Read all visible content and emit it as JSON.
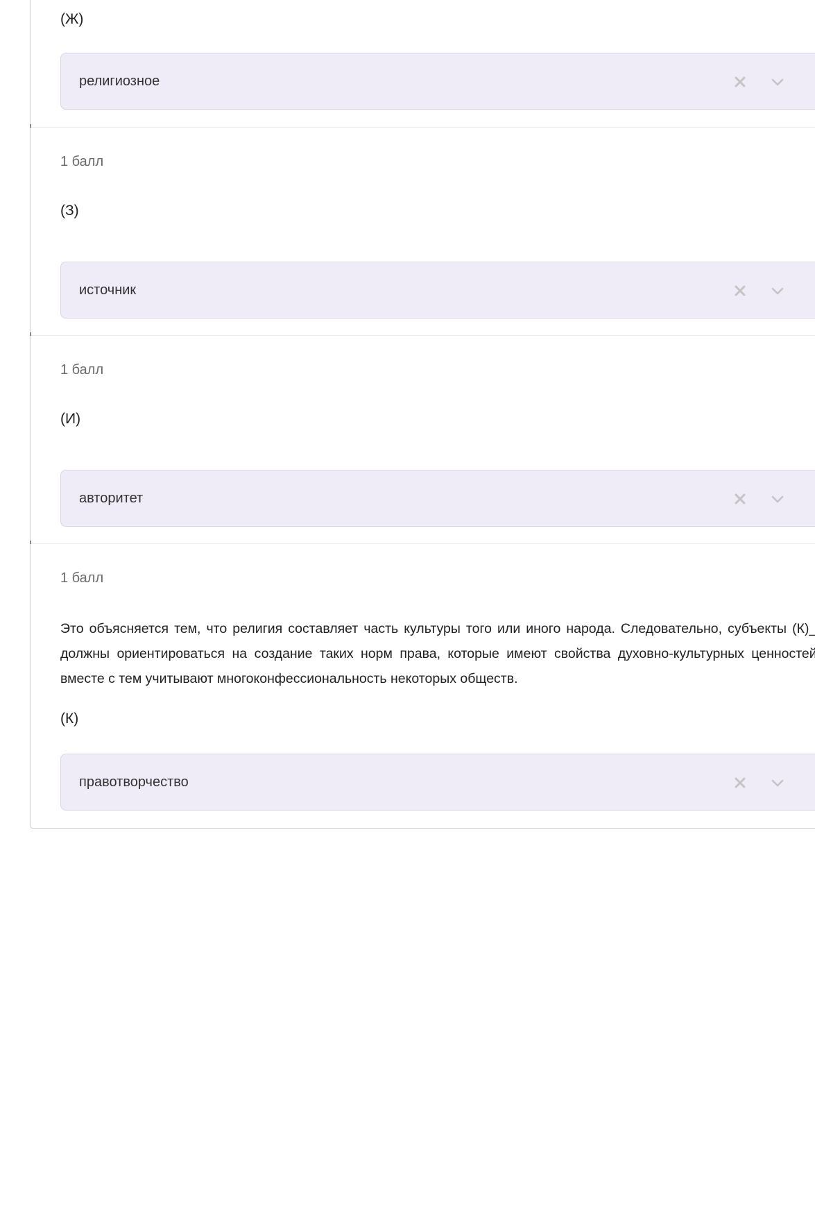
{
  "questions": [
    {
      "label": "(Ж)",
      "answer": "религиозное"
    },
    {
      "points": "1 балл",
      "label": "(З)",
      "answer": "источник"
    },
    {
      "points": "1 балл",
      "label": "(И)",
      "answer": "авторитет"
    },
    {
      "points": "1 балл",
      "description": "Это объясняется тем, что религия составляет часть культуры того или иного народа. Следовательно, субъекты (К)___ должны ориентироваться на создание таких норм права, которые имеют свойства духовно-культурных ценностей и вместе с тем учитывают многоконфессиональность некоторых обществ.",
      "label": "(К)",
      "answer": "правотворчество"
    }
  ],
  "icons": {
    "clear": "close-icon",
    "dropdown": "chevron-down-icon"
  },
  "colors": {
    "select_background": "#efecf8",
    "icon": "#c4c4c4"
  }
}
